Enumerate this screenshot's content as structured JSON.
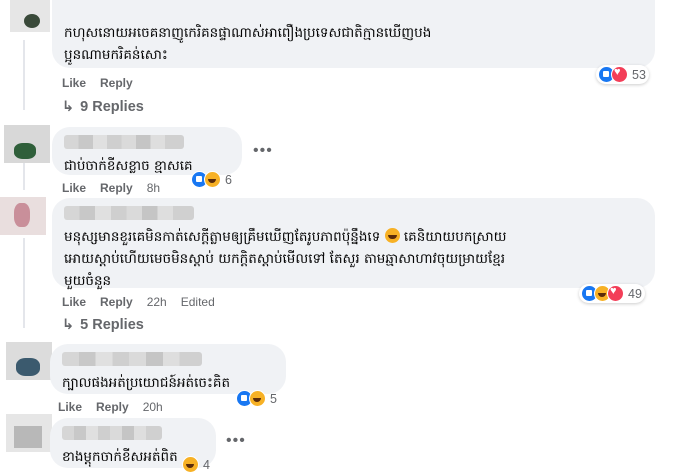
{
  "comments": [
    {
      "text": "កហុសនោយអចេគនាញូកេរិគនផ្ទាណាស់អាពឿងប្រទេសជាតិក្មានឃើញបង\nប្អូនណាមករិគន់សោះ",
      "like": "Like",
      "reply": "Reply",
      "time": "",
      "edited": "",
      "reactions": [
        "like",
        "love"
      ],
      "count": "53",
      "replies": "9 Replies"
    },
    {
      "text": "ជាប់ចាក់ខីសខ្លាច ខ្មាសគេ",
      "like": "Like",
      "reply": "Reply",
      "time": "8h",
      "edited": "",
      "reactions": [
        "like",
        "haha"
      ],
      "count": "6"
    },
    {
      "text": "មនុស្សមានខួរគេមិនកាត់សេក្តីត្លាមឲ្យគ្រឹមឃើញតែរូបភាពប៉ុន្នឹងទេ",
      "text2": " គេនិយាយបកស្រាយ\nអោយស្តាប់ហើយមេចមិនស្តាប់ យកក្តិតស្តាប់មើលទៅ តែសួរ តាមឆ្មាសាហាវចុយម្រាយខ្មែរ\nមួយចំនួន",
      "like": "Like",
      "reply": "Reply",
      "time": "22h",
      "edited": "Edited",
      "reactions": [
        "like",
        "haha",
        "love"
      ],
      "count": "49",
      "replies": "5 Replies"
    },
    {
      "text": "ក្បាលផងអត់ប្រយោជន៍អត់ចេះគិត",
      "like": "Like",
      "reply": "Reply",
      "time": "20h",
      "edited": "",
      "reactions": [
        "like",
        "haha"
      ],
      "count": "5"
    },
    {
      "text": "ខាងម្ដុកចាក់ខីសអត់ពិត",
      "like": "Like",
      "reply": "Reply",
      "time": "",
      "edited": "",
      "reactions": [
        "haha"
      ],
      "count": "4"
    }
  ]
}
